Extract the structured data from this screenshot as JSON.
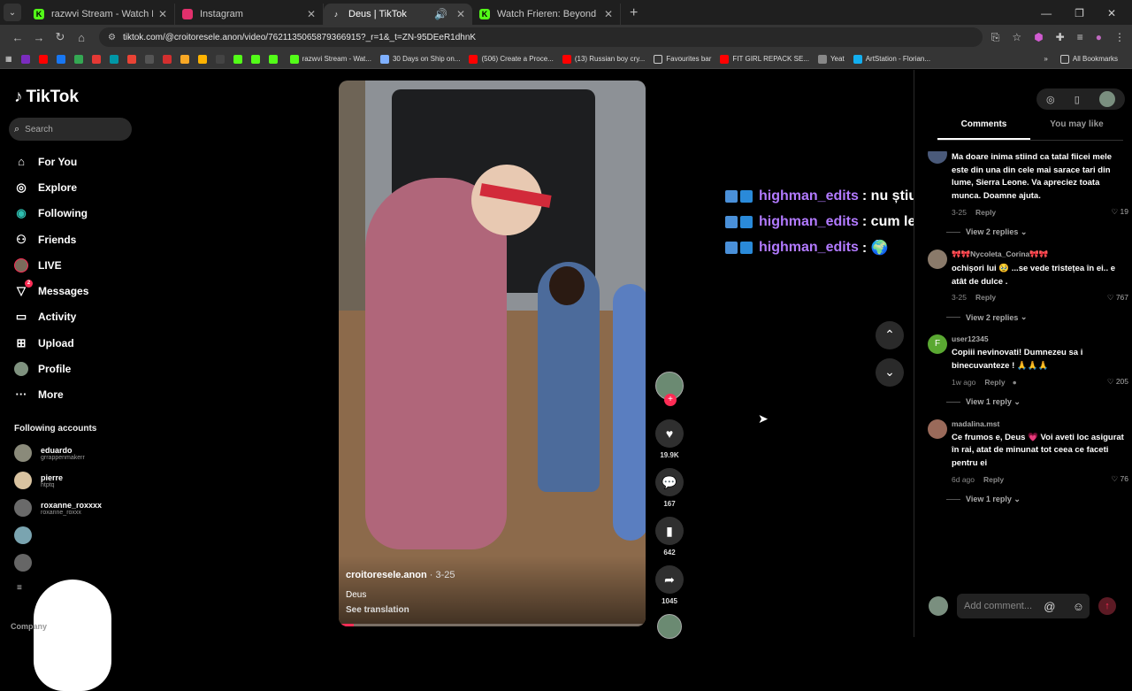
{
  "browser": {
    "tabs": [
      {
        "title": "razwvi Stream - Watch Live on Kick",
        "icon": "kick-icon",
        "color": "#53fc18",
        "active": false
      },
      {
        "title": "Instagram",
        "icon": "instagram-icon",
        "color": "#e1306c",
        "active": false
      },
      {
        "title": "Deus | TikTok",
        "icon": "tiktok-icon",
        "color": "#ffffff",
        "active": true
      },
      {
        "title": "Watch Frieren: Beyond Journey's End",
        "icon": "kick-icon",
        "color": "#53fc18",
        "active": false
      }
    ],
    "url": "tiktok.com/@croitoresele.anon/video/7621135065879366915?_r=1&_t=ZN-95DEeR1dhnK",
    "bookmarks": [
      {
        "label": "razwvi Stream - Wat...",
        "color": "#53fc18"
      },
      {
        "label": "30 Days on Ship on...",
        "color": "#7fb0ff"
      },
      {
        "label": "(506) Create a Proce...",
        "color": "#ff0000"
      },
      {
        "label": "(13) Russian boy cry...",
        "color": "#ff0000"
      },
      {
        "label": "Favourites bar",
        "color": "#cccccc"
      },
      {
        "label": "FIT GIRL REPACK SE...",
        "color": "#ff0000"
      },
      {
        "label": "Yeat",
        "color": "#888888"
      },
      {
        "label": "ArtStation - Florian...",
        "color": "#13aff0"
      }
    ],
    "all_bookmarks": "All Bookmarks"
  },
  "sidebar": {
    "logo": "TikTok",
    "search_placeholder": "Search",
    "items": [
      {
        "label": "For You",
        "icon": "home-icon",
        "glyph": "⌂"
      },
      {
        "label": "Explore",
        "icon": "compass-icon",
        "glyph": "◎"
      },
      {
        "label": "Following",
        "icon": "following-icon",
        "glyph": "◉"
      },
      {
        "label": "Friends",
        "icon": "friends-icon",
        "glyph": "⚇"
      },
      {
        "label": "LIVE",
        "icon": "live-avatar-icon",
        "glyph": ""
      },
      {
        "label": "Messages",
        "icon": "messages-icon",
        "glyph": "▽",
        "badge": "2"
      },
      {
        "label": "Activity",
        "icon": "activity-icon",
        "glyph": "▭"
      },
      {
        "label": "Upload",
        "icon": "upload-icon",
        "glyph": "⊞"
      },
      {
        "label": "Profile",
        "icon": "profile-avatar-icon",
        "glyph": ""
      },
      {
        "label": "More",
        "icon": "more-icon",
        "glyph": "···"
      }
    ],
    "following_title": "Following accounts",
    "following": [
      {
        "name": "eduardo",
        "handle": "grrappenmakerr"
      },
      {
        "name": "pierre",
        "handle": "htptq"
      },
      {
        "name": "roxanne_roxxxx",
        "handle": "roxanne_roxxx"
      }
    ],
    "company": "Company"
  },
  "video": {
    "author": "croitoresele.anon",
    "date": "3-25",
    "caption": "Deus",
    "see_translation": "See translation",
    "progress": 0.05
  },
  "actions": {
    "likes": "19.9K",
    "comments": "167",
    "saves": "642",
    "shares": "1045"
  },
  "chat_overlay": [
    {
      "user": "highman_edits",
      "message": ": nu știu"
    },
    {
      "user": "highman_edits",
      "message": ": cum le ghicești"
    },
    {
      "user": "highman_edits",
      "message": ": 🌍"
    }
  ],
  "right_panel": {
    "tabs": [
      "Comments",
      "You may like"
    ],
    "comments": [
      {
        "user": "",
        "text": "Ma doare inima stiind ca tatal fiicei mele este din una din cele mai sarace tari din lume, Sierra Leone. Va apreciez toata munca. Doamne ajuta.",
        "time": "3-25",
        "likes": "19",
        "view_replies": "View 2 replies",
        "avatar_color": "#4a5a7a"
      },
      {
        "user": "🎀🎀Nycoleta_Corina🎀🎀",
        "text": "ochișori lui 🥹 ...se vede tristețea în ei.. e atât de dulce .",
        "time": "3-25",
        "likes": "767",
        "view_replies": "View 2 replies",
        "avatar_color": "#8a7a6a"
      },
      {
        "user": "user12345",
        "text": "Copiii nevinovati! Dumnezeu sa i binecuvanteze ! 🙏🙏🙏",
        "time": "1w ago",
        "likes": "205",
        "view_replies": "View 1 reply",
        "avatar_color": "#5aa832",
        "initial": "F"
      },
      {
        "user": "madalina.mst",
        "text": "Ce frumos e, Deus 💗 Voi aveti loc asigurat în rai, atat de minunat tot ceea ce faceti pentru ei",
        "time": "6d ago",
        "likes": "76",
        "view_replies": "View 1 reply",
        "avatar_color": "#9a6a5a"
      }
    ],
    "reply_label": "Reply",
    "add_comment_placeholder": "Add comment..."
  }
}
